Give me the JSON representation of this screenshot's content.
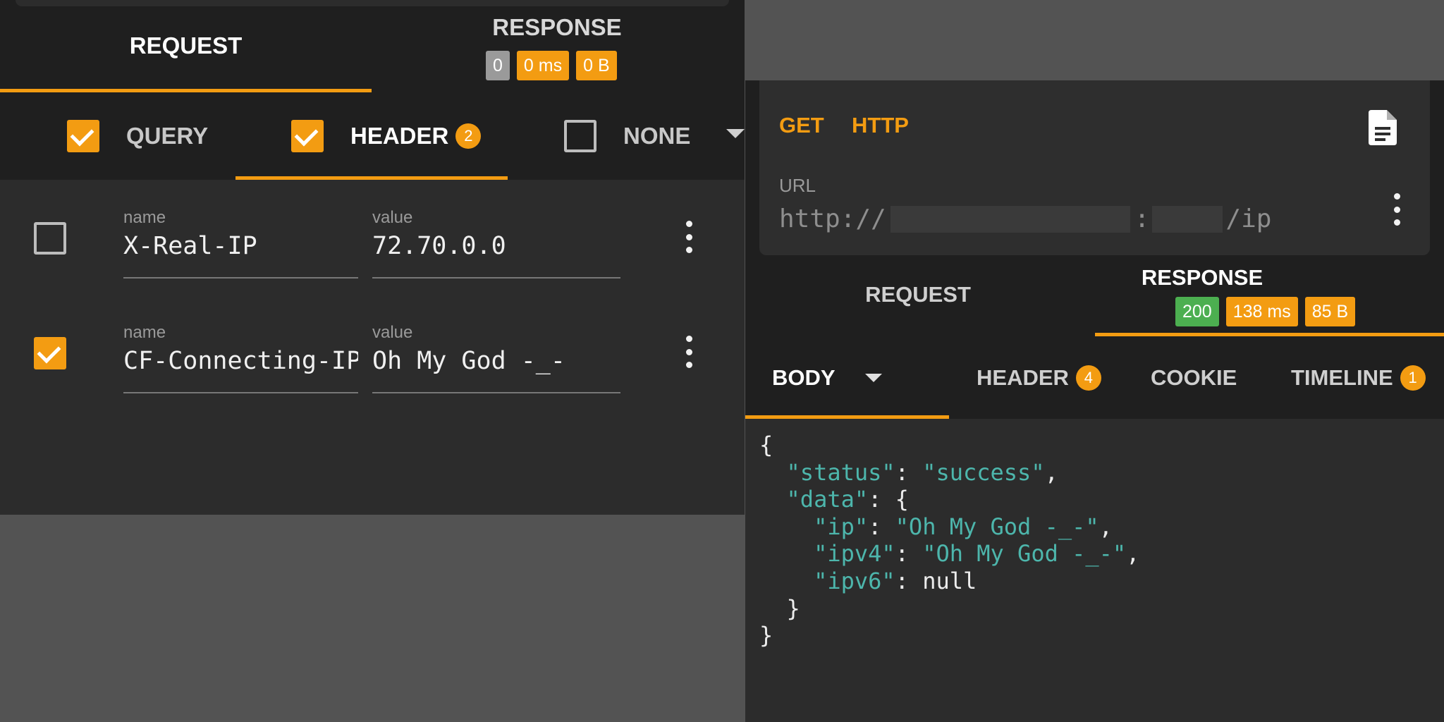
{
  "left_panel": {
    "tabs": {
      "request": "REQUEST",
      "response": "RESPONSE",
      "response_badges": [
        "0",
        "0 ms",
        "0 B"
      ]
    },
    "subtabs": {
      "query": {
        "label": "QUERY",
        "checked": true
      },
      "header": {
        "label": "HEADER",
        "checked": true,
        "count": "2"
      },
      "none": {
        "label": "NONE",
        "checked": false
      }
    },
    "headers": [
      {
        "enabled": false,
        "name_label": "name",
        "name": "X-Real-IP",
        "value_label": "value",
        "value": "72.70.0.0"
      },
      {
        "enabled": true,
        "name_label": "name",
        "name": "CF-Connecting-IP",
        "value_label": "value",
        "value": "Oh My God -_-"
      }
    ]
  },
  "right_panel": {
    "request": {
      "method": "GET",
      "protocol": "HTTP",
      "url_label": "URL",
      "url_prefix": "http://",
      "url_colon": ":",
      "url_path": "/ip"
    },
    "tabs": {
      "request": "REQUEST",
      "response": "RESPONSE",
      "response_badges": [
        "200",
        "138 ms",
        "85 B"
      ]
    },
    "body_tabs": {
      "body": "BODY",
      "header": "HEADER",
      "header_count": "4",
      "cookie": "COOKIE",
      "timeline": "TIMELINE",
      "timeline_count": "1"
    },
    "response_json": {
      "open": "{",
      "status_key": "\"status\"",
      "status_value": "\"success\"",
      "data_key": "\"data\"",
      "data_open": "{",
      "ip_key": "\"ip\"",
      "ip_value": "\"Oh My God -_-\"",
      "ipv4_key": "\"ipv4\"",
      "ipv4_value": "\"Oh My God -_-\"",
      "ipv6_key": "\"ipv6\"",
      "ipv6_value": "null",
      "data_close": "}",
      "close": "}"
    }
  },
  "colors": {
    "accent": "#f39c12",
    "success": "#4caf50",
    "json_string": "#4db6ac",
    "panel_dark": "#1f1f1f",
    "panel": "#2c2c2c"
  },
  "icons": [
    "check-icon",
    "chevron-down-icon",
    "more-vert-icon",
    "document-icon"
  ]
}
